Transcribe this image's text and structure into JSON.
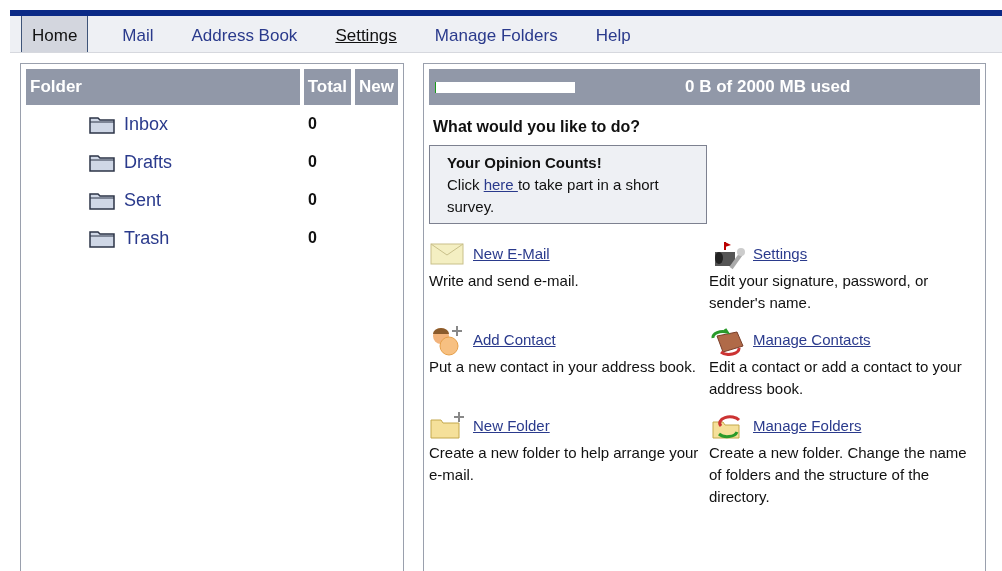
{
  "nav": [
    {
      "label": "Home",
      "selected": true,
      "hovered": false
    },
    {
      "label": "Mail",
      "selected": false,
      "hovered": false
    },
    {
      "label": "Address Book",
      "selected": false,
      "hovered": false
    },
    {
      "label": "Settings",
      "selected": false,
      "hovered": true
    },
    {
      "label": "Manage Folders",
      "selected": false,
      "hovered": false
    },
    {
      "label": "Help",
      "selected": false,
      "hovered": false
    }
  ],
  "folders": {
    "columns": [
      "Folder",
      "Total",
      "New"
    ],
    "rows": [
      {
        "name": "Inbox",
        "total": "0"
      },
      {
        "name": "Drafts",
        "total": "0"
      },
      {
        "name": "Sent",
        "total": "0"
      },
      {
        "name": "Trash",
        "total": "0"
      }
    ]
  },
  "storage": {
    "level": 0.005,
    "reading": "0 B of 2000 MB used"
  },
  "heading": "What would you like to do?",
  "survey": {
    "title": "Your Opinion Counts!",
    "before": "Click ",
    "link": "here ",
    "after": "to take part in a short survey."
  },
  "actions": [
    {
      "kind": "envelope",
      "link": "New E-Mail",
      "description": "Write and send e-mail."
    },
    {
      "kind": "settings",
      "link": "Settings",
      "description": "Edit your signature, password, or sender's name."
    },
    {
      "kind": "contact",
      "link": "Add Contact",
      "description": "Put a new contact in your address book."
    },
    {
      "kind": "book",
      "link": "Manage Contacts",
      "description": "Edit a contact or add a contact to your address book."
    },
    {
      "kind": "newfolder",
      "link": "New Folder",
      "description": "Create a new folder to help arrange your e-mail."
    },
    {
      "kind": "movefolder",
      "link": "Manage Folders",
      "description": "Create a new folder. Change the name of folders and the structure of the directory."
    }
  ]
}
